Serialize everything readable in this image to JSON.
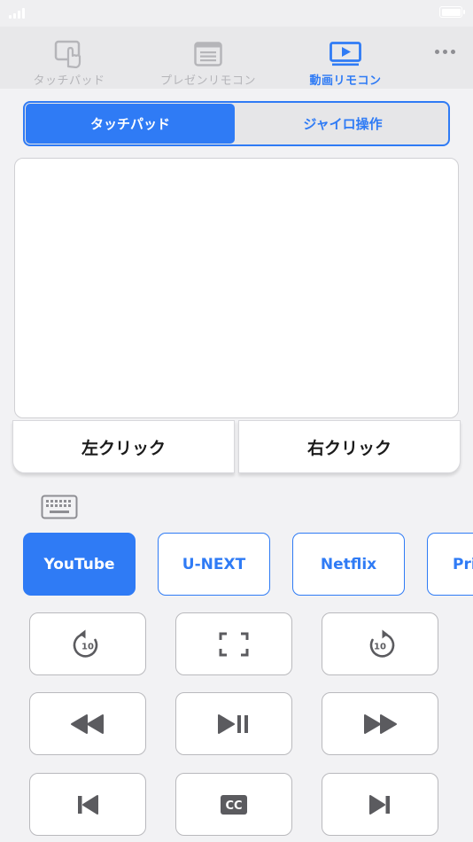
{
  "colors": {
    "accent": "#2f7bf5",
    "icon_gray": "#5b5b5f",
    "inactive_tab": "#b5b5b9"
  },
  "tabs": [
    {
      "label": "タッチパッド",
      "icon": "touch-hand-icon",
      "active": false
    },
    {
      "label": "プレゼンリモコン",
      "icon": "slides-icon",
      "active": false
    },
    {
      "label": "動画リモコン",
      "icon": "video-play-icon",
      "active": true
    }
  ],
  "more_icon": "more-dots-icon",
  "segmented": {
    "left": "タッチパッド",
    "right": "ジャイロ操作",
    "selected": "left"
  },
  "clicks": {
    "left": "左クリック",
    "right": "右クリック"
  },
  "keyboard_icon": "keyboard-icon",
  "services": [
    {
      "label": "YouTube",
      "selected": true
    },
    {
      "label": "U-NEXT",
      "selected": false
    },
    {
      "label": "Netflix",
      "selected": false
    },
    {
      "label": "Pri",
      "selected": false
    }
  ],
  "controls": {
    "replay10": {
      "icon": "replay-10-icon",
      "text": "10"
    },
    "fullscreen": {
      "icon": "fullscreen-icon"
    },
    "forward10": {
      "icon": "forward-10-icon",
      "text": "10"
    },
    "rewind": {
      "icon": "rewind-icon"
    },
    "play_pause": {
      "icon": "play-pause-icon"
    },
    "fast_forward": {
      "icon": "fast-forward-icon"
    },
    "previous": {
      "icon": "skip-previous-icon"
    },
    "captions": {
      "icon": "closed-captions-icon",
      "text": "CC"
    },
    "next": {
      "icon": "skip-next-icon"
    }
  }
}
